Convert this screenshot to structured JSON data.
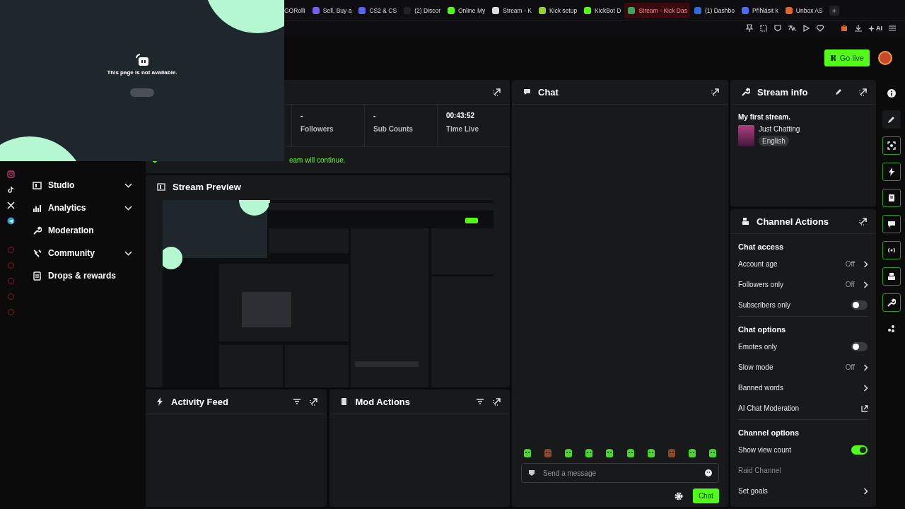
{
  "browser": {
    "tabs": [
      {
        "label": "GORolli",
        "selected": false
      },
      {
        "label": "Sell, Buy a",
        "selected": false
      },
      {
        "label": "CS2 & CS",
        "selected": false
      },
      {
        "label": "(2) Discor",
        "selected": false
      },
      {
        "label": "Online My",
        "selected": false
      },
      {
        "label": "Stream - K",
        "selected": false
      },
      {
        "label": "Kick setup",
        "selected": false
      },
      {
        "label": "KickBot D",
        "selected": false
      },
      {
        "label": "Stream - Kick Das",
        "selected": true
      },
      {
        "label": "(1) Dashbo",
        "selected": false
      },
      {
        "label": "Přihlásit k",
        "selected": false
      },
      {
        "label": "Unbox AS",
        "selected": false
      }
    ],
    "new_tab": "+",
    "ai_label": "AI"
  },
  "header": {
    "go_live": "Go live"
  },
  "sidebar": {
    "items": [
      {
        "label": "Studio",
        "expandable": true
      },
      {
        "label": "Analytics",
        "expandable": true
      },
      {
        "label": "Moderation",
        "expandable": false
      },
      {
        "label": "Community",
        "expandable": true
      },
      {
        "label": "Drops & rewards",
        "expandable": false
      }
    ]
  },
  "stats": {
    "items": [
      {
        "value": "-",
        "label": "Followers"
      },
      {
        "value": "-",
        "label": "Sub Counts"
      },
      {
        "value": "00:43:52",
        "label": "Time Live"
      }
    ],
    "notice": "eam will continue."
  },
  "stream_preview": {
    "title": "Stream Preview",
    "kind": "picture"
  },
  "activity_feed": {
    "title": "Activity Feed"
  },
  "mod_actions": {
    "title": "Mod Actions"
  },
  "chat": {
    "title": "Chat",
    "placeholder": "Send a message",
    "send_button": "Chat"
  },
  "stream_info": {
    "title": "Stream info",
    "stream_title": "My first stream.",
    "category": "Just Chatting",
    "language": "English"
  },
  "channel_actions": {
    "title": "Channel Actions",
    "sections": [
      {
        "title": "Chat access",
        "rows": [
          {
            "kind": "value",
            "label": "Account age",
            "value": "Off"
          },
          {
            "kind": "value",
            "label": "Followers only",
            "value": "Off"
          },
          {
            "kind": "toggle",
            "label": "Subscribers only",
            "on": false
          }
        ]
      },
      {
        "title": "Chat options",
        "rows": [
          {
            "kind": "toggle",
            "label": "Emotes only",
            "on": false
          },
          {
            "kind": "value",
            "label": "Slow mode",
            "value": "Off"
          },
          {
            "kind": "link",
            "label": "Banned words"
          },
          {
            "kind": "external",
            "label": "AI Chat Moderation"
          }
        ]
      },
      {
        "title": "Channel options",
        "rows": [
          {
            "kind": "toggle",
            "label": "Show view count",
            "on": true
          },
          {
            "kind": "disabled",
            "label": "Raid Channel"
          },
          {
            "kind": "link",
            "label": "Set goals"
          }
        ]
      }
    ]
  },
  "overlay": {
    "message": "This page is not available."
  }
}
